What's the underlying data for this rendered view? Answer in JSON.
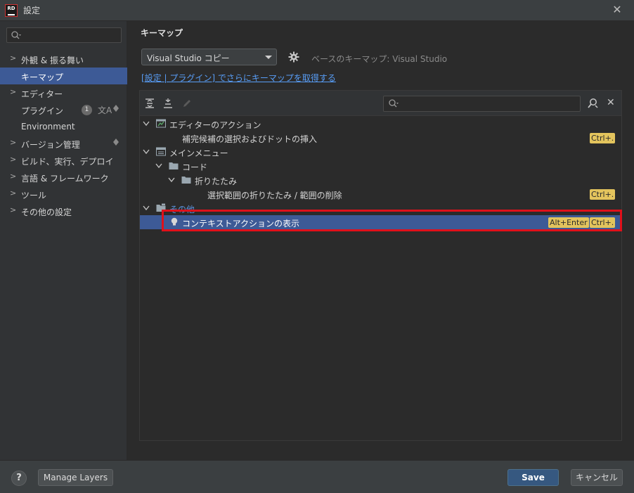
{
  "window": {
    "logo_text": "RD",
    "title": "設定",
    "close_glyph": "✕"
  },
  "sidebar": {
    "search_placeholder": "",
    "items": [
      {
        "label": "外観 & 振る舞い",
        "expandable": true
      },
      {
        "label": "キーマップ",
        "expandable": false,
        "selected": true
      },
      {
        "label": "エディター",
        "expandable": true
      },
      {
        "label": "プラグイン",
        "expandable": false,
        "badge": "1"
      },
      {
        "label": "Environment",
        "expandable": false
      },
      {
        "label": "バージョン管理",
        "expandable": true
      },
      {
        "label": "ビルド、実行、デプロイ",
        "expandable": true
      },
      {
        "label": "言語 & フレームワーク",
        "expandable": true
      },
      {
        "label": "ツール",
        "expandable": true
      },
      {
        "label": "その他の設定",
        "expandable": true
      }
    ]
  },
  "main": {
    "title": "キーマップ",
    "keymap_value": "Visual Studio コピー",
    "base_keymap": "ベースのキーマップ: Visual Studio",
    "plugin_link": "[設定 | プラグイン] でさらにキーマップを取得する",
    "filter_placeholder": ""
  },
  "tree": {
    "rows": [
      {
        "label": "エディターのアクション",
        "shortcuts": []
      },
      {
        "label": "補完候補の選択およびドットの挿入",
        "shortcuts": [
          "Ctrl+."
        ]
      },
      {
        "label": "メインメニュー",
        "shortcuts": []
      },
      {
        "label": "コード",
        "shortcuts": []
      },
      {
        "label": "折りたたみ",
        "shortcuts": []
      },
      {
        "label": "選択範囲の折りたたみ / 範囲の削除",
        "shortcuts": [
          "Ctrl+."
        ]
      },
      {
        "label": "その他",
        "shortcuts": []
      },
      {
        "label": "コンテキストアクションの表示",
        "shortcuts": [
          "Alt+Enter",
          "Ctrl+."
        ],
        "selected": true
      }
    ]
  },
  "footer": {
    "help": "?",
    "manage_layers": "Manage Layers",
    "save": "Save",
    "cancel": "キャンセル"
  },
  "colors": {
    "selection": "#3d5a96",
    "shortcut_badge": "#e3c45d",
    "highlight": "#e0101a",
    "link": "#589df6"
  }
}
